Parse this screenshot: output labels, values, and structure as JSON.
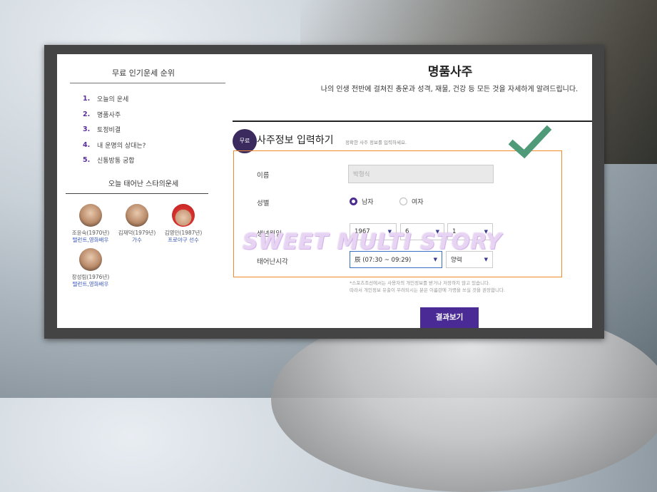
{
  "left": {
    "ranking_title": "무료 인기운세 순위",
    "ranking": [
      {
        "num": "1.",
        "label": "오늘의 운세"
      },
      {
        "num": "2.",
        "label": "명품사주"
      },
      {
        "num": "3.",
        "label": "토정비결"
      },
      {
        "num": "4.",
        "label": "내 운명의 상대는?"
      },
      {
        "num": "5.",
        "label": "신통방통 궁합"
      }
    ],
    "stars_title": "오늘 태어난 스타의운세",
    "stars": [
      {
        "name": "조윤숙(1970년)",
        "job": "탤런트,영화배우"
      },
      {
        "name": "김재덕(1979년)",
        "job": "가수"
      },
      {
        "name": "김영민(1987년)",
        "job": "프로야구 선수"
      },
      {
        "name": "장성림(1976년)",
        "job": "탤런트,영화배우"
      }
    ]
  },
  "main": {
    "title": "명품사주",
    "subtitle": "나의 인생 전반에 걸쳐진 총운과 성격, 재물, 건강 등 모든 것을 자세하게 알려드립니다.",
    "badge": "무료",
    "section_title": "사주정보 입력하기",
    "section_hint": "정확한 사주 정보를 입력하세요.",
    "form": {
      "name_label": "이름",
      "name_value": "박형식",
      "gender_label": "성별",
      "gender_male": "남자",
      "gender_female": "여자",
      "gender_selected": "남자",
      "birth_label": "생년월일",
      "year": "1967",
      "month": "6",
      "day": "1",
      "time_label": "태어난시각",
      "time": "辰 (07:30 ~ 09:29)",
      "calendar": "양력"
    },
    "notice_1": "*스포츠조선에서는 사용자의 개인정보를 받거나 저장하지 않고 있습니다.",
    "notice_2": "따라서 개인정보 유출이 우려되시는 분은 이름란에 가명을 쓰실 것을 권장합니다.",
    "result_button": "결과보기"
  },
  "watermark": "SWEET MULTI STORY",
  "colors": {
    "accent_purple": "#4a2b95",
    "highlight_orange": "#f08a2c",
    "checkmark_green": "#4f9a78"
  }
}
